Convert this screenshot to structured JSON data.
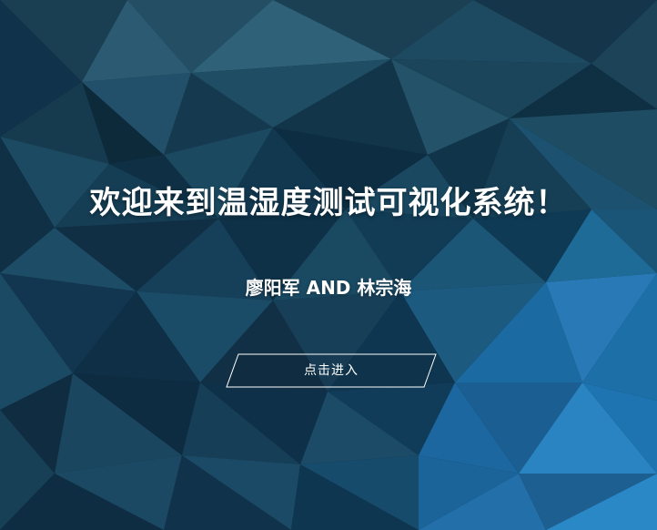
{
  "page": {
    "title": "欢迎来到温湿度测试可视化系统！",
    "authors": "廖阳军 AND 林宗海",
    "enter_button": {
      "label": "点击进入"
    }
  },
  "colors": {
    "background_base": "#0d2a3b",
    "text": "#ffffff",
    "button_border": "#ffffff",
    "accent_blue": "#1c77b7"
  }
}
